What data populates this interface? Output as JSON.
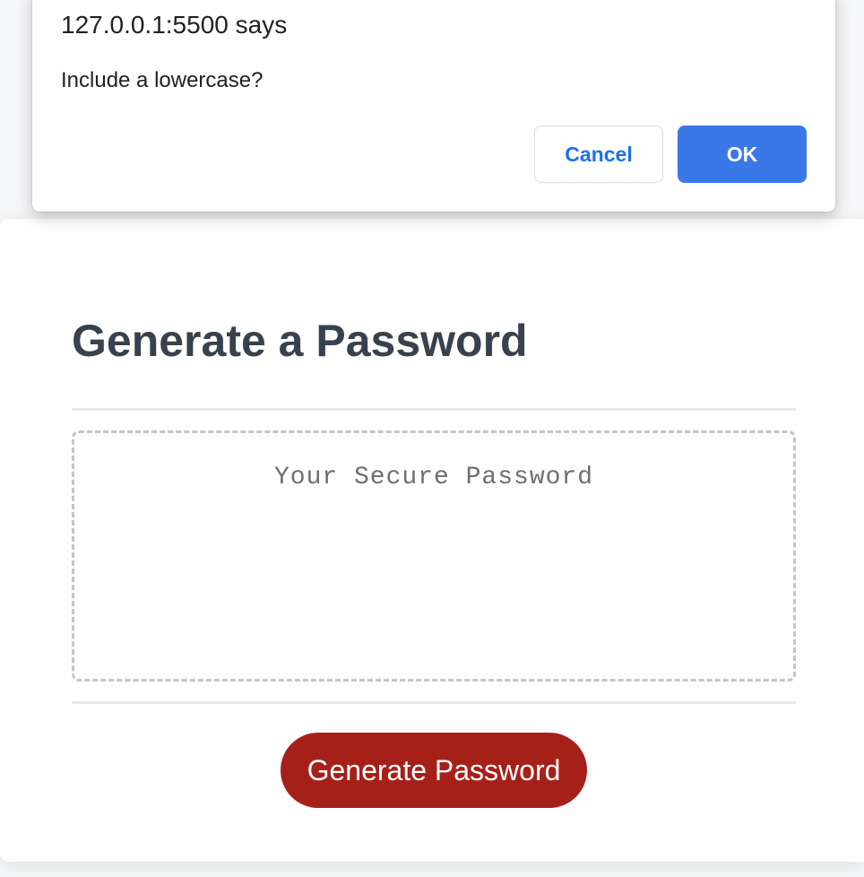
{
  "dialog": {
    "origin": "127.0.0.1:5500 says",
    "message": "Include a lowercase?",
    "cancel_label": "Cancel",
    "ok_label": "OK"
  },
  "card": {
    "title": "Generate a Password",
    "password_placeholder": "Your Secure Password",
    "password_value": "",
    "generate_label": "Generate Password"
  },
  "colors": {
    "title": "#37424e",
    "generate_button": "#a6201a",
    "ok_button": "#3b78e7",
    "cancel_text": "#1a73e8"
  }
}
